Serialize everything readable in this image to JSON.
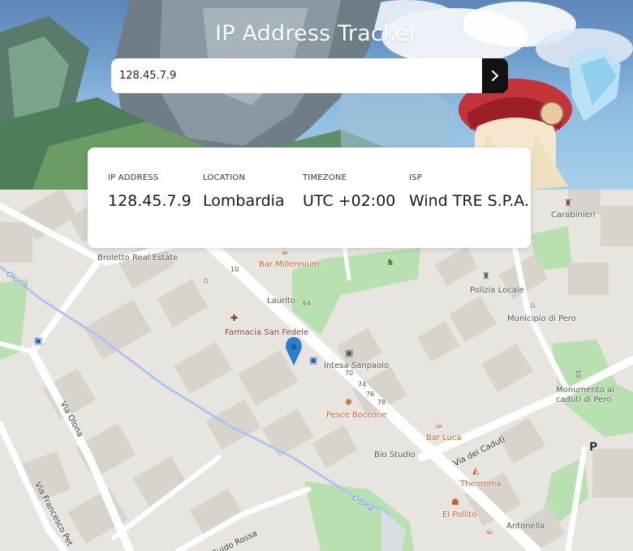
{
  "header": {
    "title": "IP Address Tracker",
    "search_value": "128.45.7.9",
    "submit_icon": "chevron-right-icon"
  },
  "info": {
    "ip": {
      "label": "IP ADDRESS",
      "value": "128.45.7.9"
    },
    "location": {
      "label": "LOCATION",
      "value": "Lombardia"
    },
    "timezone": {
      "label": "TIMEZONE",
      "value": "UTC +02:00"
    },
    "isp": {
      "label": "ISP",
      "value": "Wind TRE S.P.A."
    }
  },
  "map": {
    "pois": {
      "carabinieri": "Carabinieri",
      "broletto": "Broletto Real Estate",
      "bar_millennium": "Bar Millennium",
      "polizia": "Polizia Locale",
      "municipio": "Municipio di Pero",
      "laurito": "Laurito",
      "farmacia": "Farmacia San Fedele",
      "intesa": "Intesa Sanpaolo",
      "monumento_1": "Monumento ai",
      "monumento_2": "caduti di Pero",
      "pesce": "Pesce Boccone",
      "bar_luca": "Bar Luca",
      "bio_studio": "Bio Studio",
      "theorema": "Theorema",
      "pollito": "El Pollito",
      "antonella": "Antonella",
      "parking": "P"
    },
    "streets": {
      "olona_top": "Olona",
      "olona_bottom": "Olona",
      "via_olona": "Via Olona",
      "via_caduti": "Via dei Caduti",
      "via_francesco": "Via Francesco Pet",
      "guido_rossa": "Guido Rossa"
    },
    "house_numbers": [
      "10",
      "64",
      "70",
      "74",
      "76",
      "78"
    ],
    "colors": {
      "park": "#b9e0b0",
      "water": "#aac8ef",
      "building": "#d9d3cd",
      "marker": "#2a7fce"
    }
  }
}
